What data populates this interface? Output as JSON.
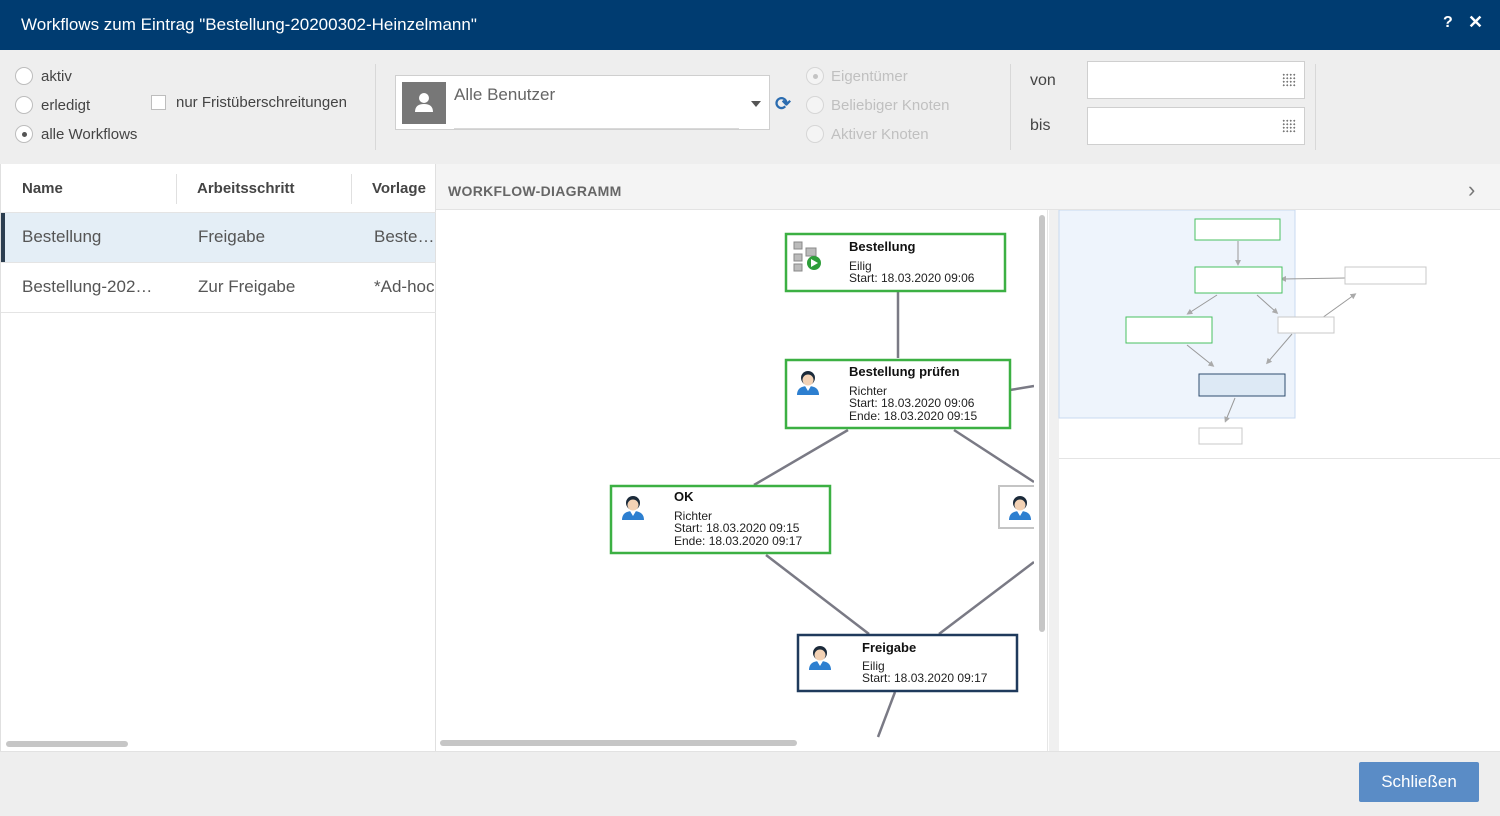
{
  "window": {
    "title": "Workflows zum Eintrag \"Bestellung-20200302-Heinzelmann\"",
    "help": "?",
    "close": "✕"
  },
  "filters": {
    "status": [
      {
        "label": "aktiv",
        "checked": false
      },
      {
        "label": "erledigt",
        "checked": false
      },
      {
        "label": "alle Workflows",
        "checked": true
      }
    ],
    "overdue_label": "nur Fristüberschreitungen",
    "user_select": "Alle Benutzer",
    "reset_icon": "⟳",
    "scope": [
      {
        "label": "Eigentümer",
        "checked": true
      },
      {
        "label": "Beliebiger Knoten",
        "checked": false
      },
      {
        "label": "Aktiver Knoten",
        "checked": false
      }
    ],
    "from_label": "von",
    "to_label": "bis",
    "from_value": "",
    "to_value": ""
  },
  "table": {
    "columns": [
      "Name",
      "Arbeitsschritt",
      "Vorlage"
    ],
    "rows": [
      {
        "name": "Bestellung",
        "step": "Freigabe",
        "template": "Bestel…"
      },
      {
        "name": "Bestellung-202…",
        "step": "Zur Freigabe",
        "template": "*Ad-hoc"
      }
    ]
  },
  "diagram": {
    "header": "WORKFLOW-DIAGRAMM",
    "chevron": "›",
    "nodes": [
      {
        "title": "Bestellung",
        "lines": [
          "Eilig",
          "Start: 18.03.2020 09:06"
        ]
      },
      {
        "title": "Bestellung prüfen",
        "lines": [
          "Richter",
          "Start: 18.03.2020 09:06",
          "Ende: 18.03.2020 09:15"
        ]
      },
      {
        "title": "OK",
        "lines": [
          "Richter",
          "Start: 18.03.2020 09:15",
          "Ende: 18.03.2020 09:17"
        ]
      },
      {
        "title": "Freigabe",
        "lines": [
          "Eilig",
          "Start: 18.03.2020 09:17"
        ]
      }
    ]
  },
  "footer": {
    "close_button": "Schließen"
  }
}
